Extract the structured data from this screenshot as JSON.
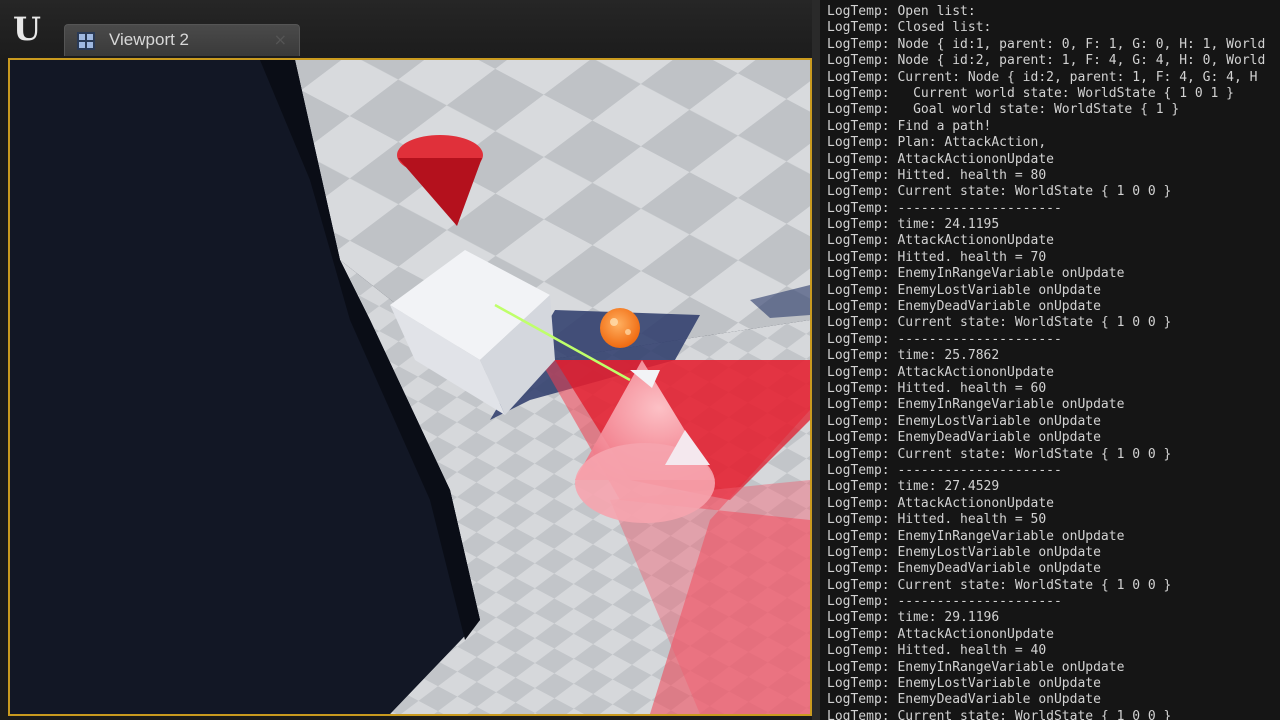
{
  "app": {
    "logo_glyph": "U"
  },
  "tab": {
    "label": "Viewport 2",
    "close_glyph": "×",
    "icon": "viewport-grid-icon"
  },
  "colors": {
    "viewport_border": "#c99a1f",
    "cone_red": "#c8101e",
    "console_text": "#d2d2d2"
  },
  "log": {
    "lines": [
      "LogTemp: Open list:",
      "LogTemp: Closed list:",
      "LogTemp: Node { id:1, parent: 0, F: 1, G: 0, H: 1, World",
      "LogTemp: Node { id:2, parent: 1, F: 4, G: 4, H: 0, World",
      "LogTemp: Current: Node { id:2, parent: 1, F: 4, G: 4, H",
      "LogTemp:   Current world state: WorldState { 1 0 1 }",
      "LogTemp:   Goal world state: WorldState { 1 }",
      "LogTemp: Find a path!",
      "LogTemp: Plan: AttackAction,",
      "LogTemp: AttackActiononUpdate",
      "LogTemp: Hitted. health = 80",
      "LogTemp: Current state: WorldState { 1 0 0 }",
      "LogTemp: ---------------------",
      "LogTemp: time: 24.1195",
      "LogTemp: AttackActiononUpdate",
      "LogTemp: Hitted. health = 70",
      "LogTemp: EnemyInRangeVariable onUpdate",
      "LogTemp: EnemyLostVariable onUpdate",
      "LogTemp: EnemyDeadVariable onUpdate",
      "LogTemp: Current state: WorldState { 1 0 0 }",
      "LogTemp: ---------------------",
      "LogTemp: time: 25.7862",
      "LogTemp: AttackActiononUpdate",
      "LogTemp: Hitted. health = 60",
      "LogTemp: EnemyInRangeVariable onUpdate",
      "LogTemp: EnemyLostVariable onUpdate",
      "LogTemp: EnemyDeadVariable onUpdate",
      "LogTemp: Current state: WorldState { 1 0 0 }",
      "LogTemp: ---------------------",
      "LogTemp: time: 27.4529",
      "LogTemp: AttackActiononUpdate",
      "LogTemp: Hitted. health = 50",
      "LogTemp: EnemyInRangeVariable onUpdate",
      "LogTemp: EnemyLostVariable onUpdate",
      "LogTemp: EnemyDeadVariable onUpdate",
      "LogTemp: Current state: WorldState { 1 0 0 }",
      "LogTemp: ---------------------",
      "LogTemp: time: 29.1196",
      "LogTemp: AttackActiononUpdate",
      "LogTemp: Hitted. health = 40",
      "LogTemp: EnemyInRangeVariable onUpdate",
      "LogTemp: EnemyLostVariable onUpdate",
      "LogTemp: EnemyDeadVariable onUpdate",
      "LogTemp: Current state: WorldState { 1 0 0 }"
    ]
  }
}
